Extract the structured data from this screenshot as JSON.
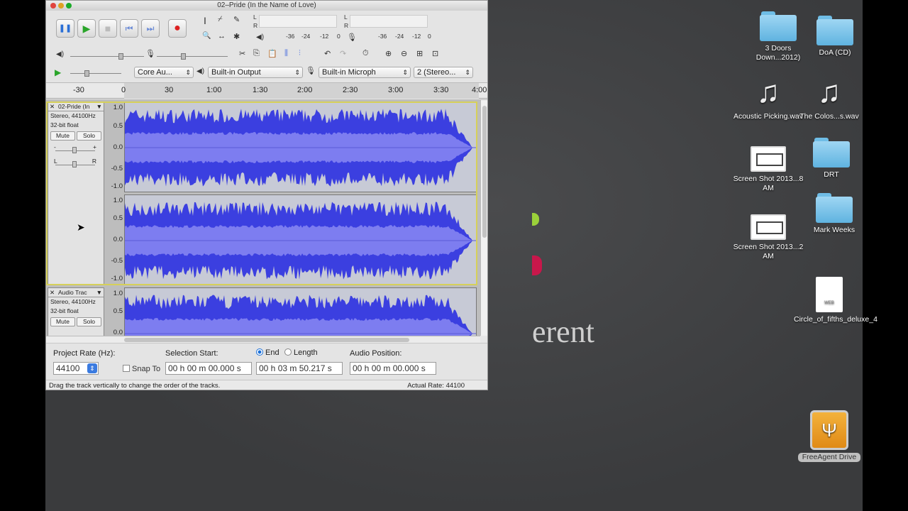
{
  "window": {
    "title": "02–Pride (In the Name of Love)"
  },
  "transport": {
    "pause": "❚❚",
    "play": "▶",
    "stop": "■",
    "skip_start": "⏮",
    "skip_end": "⏭",
    "record": "●"
  },
  "tools": {
    "select": "I",
    "envelope": "⌿",
    "draw": "✎",
    "zoom": "🔍",
    "timeshift": "↔",
    "multi": "✱"
  },
  "meters": {
    "output_ticks": [
      "-36",
      "-24",
      "-12",
      "0"
    ],
    "input_ticks": [
      "-36",
      "-24",
      "-12",
      "0"
    ],
    "l": "L",
    "r": "R"
  },
  "device_toolbar": {
    "host": "Core Au...",
    "output": "Built-in Output",
    "input": "Built-in Microph",
    "channels": "2 (Stereo..."
  },
  "ruler": {
    "labels": [
      "-30",
      "0",
      "30",
      "1:00",
      "1:30",
      "2:00",
      "2:30",
      "3:00",
      "3:30",
      "4:00"
    ]
  },
  "tracks": [
    {
      "name": "02-Pride (In",
      "format": "Stereo, 44100Hz",
      "bits": "32-bit float",
      "mute": "Mute",
      "solo": "Solo",
      "gain_minus": "-",
      "gain_plus": "+",
      "pan_l": "L",
      "pan_r": "R",
      "scale": [
        "1.0",
        "0.5",
        "0.0",
        "-0.5",
        "-1.0"
      ],
      "scale2": [
        "1.0",
        "0.5",
        "0.0",
        "-0.5",
        "-1.0"
      ]
    },
    {
      "name": "Audio Trac",
      "format": "Stereo, 44100Hz",
      "bits": "32-bit float",
      "mute": "Mute",
      "solo": "Solo",
      "scale": [
        "1.0",
        "0.5",
        "0.0"
      ]
    }
  ],
  "selection_bar": {
    "project_rate_label": "Project Rate (Hz):",
    "project_rate": "44100",
    "snap_to": "Snap To",
    "selection_start_label": "Selection Start:",
    "end_label": "End",
    "length_label": "Length",
    "audio_position_label": "Audio Position:",
    "start_value": "00 h 00 m 00.000 s",
    "end_value": "00 h 03 m 50.217 s",
    "position_value": "00 h 00 m 00.000 s"
  },
  "status": {
    "message": "Drag the track vertically to change the order of the tracks.",
    "actual_rate": "Actual Rate: 44100"
  },
  "desktop": {
    "wallpaper_text": "erent",
    "icons": {
      "threedoors": "3 Doors Down...2012)",
      "doa": "DoA (CD)",
      "acoustic": "Acoustic Picking.wav",
      "colos": "The Colos...s.wav",
      "shot1": "Screen Shot 2013...8 AM",
      "drt": "DRT",
      "shot2": "Screen Shot 2013...2 AM",
      "markweeks": "Mark Weeks",
      "circle": "Circle_of_fifths_deluxe_4",
      "circle_tag": "WEB",
      "drive": "FreeAgent Drive"
    }
  },
  "colors": {
    "waveform": "#3b3fe0",
    "rms": "#7d7df0",
    "selection_outline": "#d6d05a",
    "record": "#d22"
  }
}
